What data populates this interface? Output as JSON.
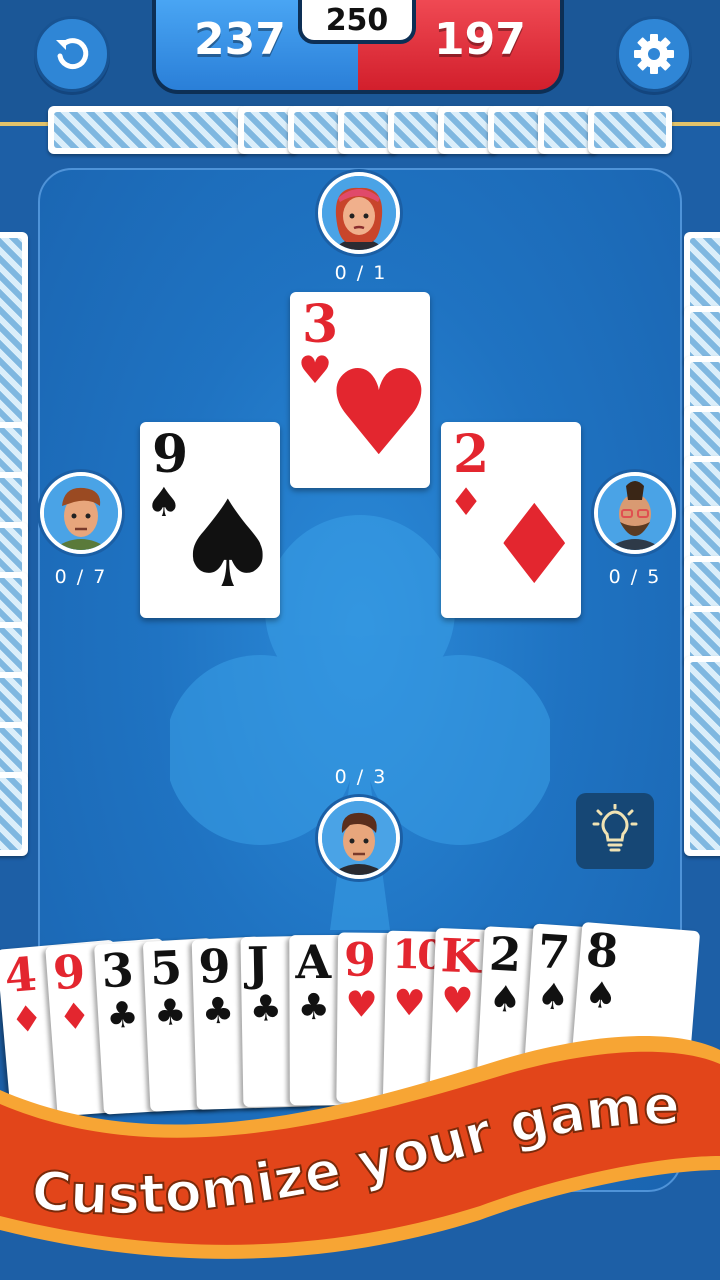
{
  "scores": {
    "team_blue": "237",
    "team_red": "197",
    "target": "250"
  },
  "players": {
    "top": {
      "tricks": "0 / 1"
    },
    "left": {
      "tricks": "0 / 7"
    },
    "right": {
      "tricks": "0 / 5"
    },
    "bottom": {
      "tricks": "0 / 3"
    }
  },
  "played_cards": {
    "top": {
      "rank": "3",
      "suit": "♥"
    },
    "left": {
      "rank": "9",
      "suit": "♠"
    },
    "right": {
      "rank": "2",
      "suit": "♦"
    }
  },
  "hand": [
    {
      "rank": "4",
      "suit": "♦"
    },
    {
      "rank": "9",
      "suit": "♦"
    },
    {
      "rank": "3",
      "suit": "♣"
    },
    {
      "rank": "5",
      "suit": "♣"
    },
    {
      "rank": "9",
      "suit": "♣"
    },
    {
      "rank": "J",
      "suit": "♣"
    },
    {
      "rank": "A",
      "suit": "♣"
    },
    {
      "rank": "9",
      "suit": "♥"
    },
    {
      "rank": "10",
      "suit": "♥"
    },
    {
      "rank": "K",
      "suit": "♥"
    },
    {
      "rank": "2",
      "suit": "♠"
    },
    {
      "rank": "7",
      "suit": "♠"
    },
    {
      "rank": "8",
      "suit": "♠"
    }
  ],
  "banner": {
    "text": "Customize your game"
  },
  "icons": {
    "undo": "undo-icon",
    "settings": "gear-icon",
    "hint": "lightbulb-icon"
  },
  "colors": {
    "felt": "#1f73c2",
    "team_blue": "#2a7fd8",
    "team_red": "#d21f2c",
    "banner": "#e2451a"
  }
}
